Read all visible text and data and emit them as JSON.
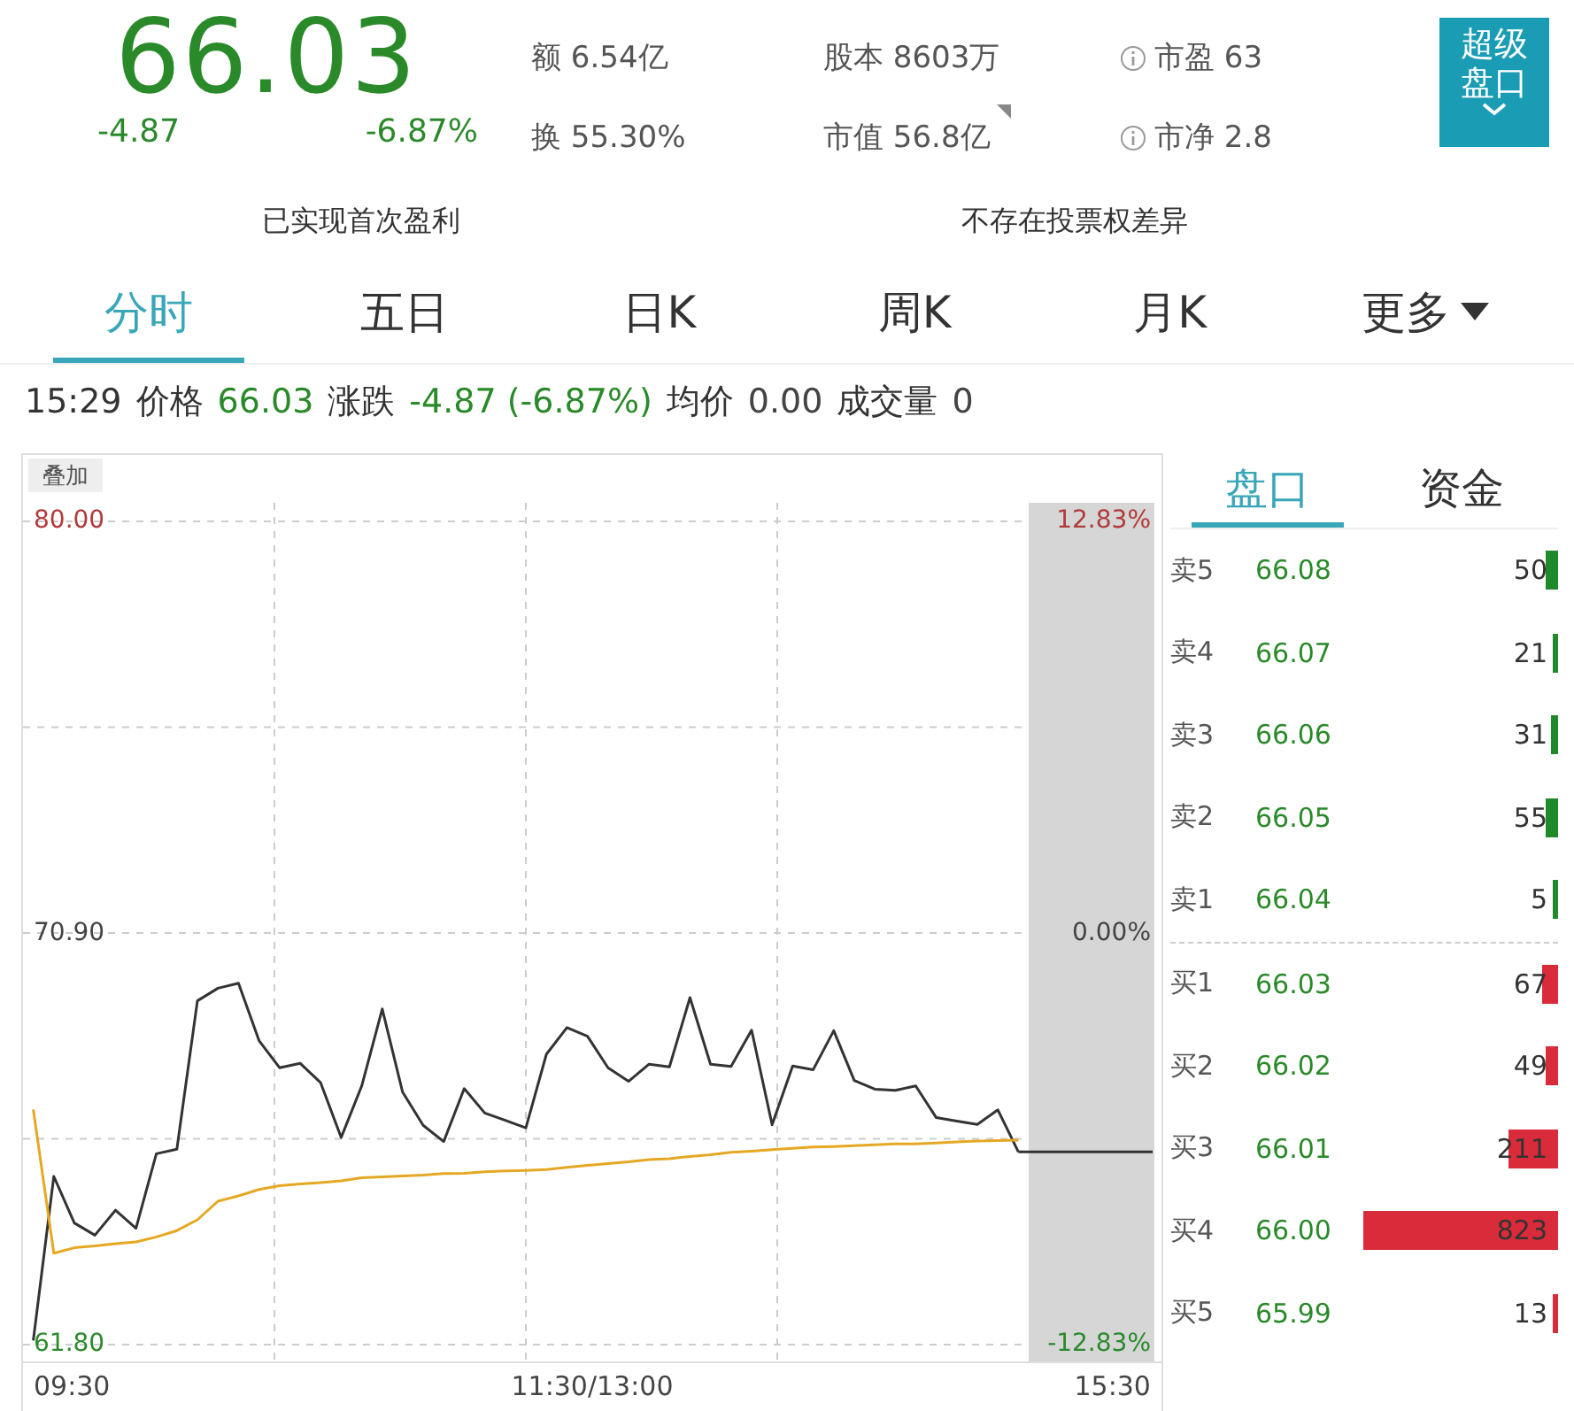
{
  "quote": {
    "price": "66.03",
    "change": "-4.87",
    "change_pct": "-6.87%"
  },
  "stats": [
    {
      "label": "额",
      "value": "6.54亿",
      "flag": false
    },
    {
      "label": "换",
      "value": "55.30%",
      "flag": false
    },
    {
      "label": "股本",
      "value": "8603万",
      "flag": false
    },
    {
      "label": "市值",
      "value": "56.8亿",
      "flag": true
    }
  ],
  "ratios": [
    {
      "label": "市盈",
      "value": "63"
    },
    {
      "label": "市净",
      "value": "2.8"
    }
  ],
  "super_button": {
    "label": "超级盘口"
  },
  "notes": [
    "已实现首次盈利",
    "不存在投票权差异"
  ],
  "tabs": [
    {
      "label": "分时",
      "selected": true,
      "dropdown": false
    },
    {
      "label": "五日",
      "selected": false,
      "dropdown": false
    },
    {
      "label": "日K",
      "selected": false,
      "dropdown": false
    },
    {
      "label": "周K",
      "selected": false,
      "dropdown": false
    },
    {
      "label": "月K",
      "selected": false,
      "dropdown": false
    },
    {
      "label": "更多",
      "selected": false,
      "dropdown": true
    }
  ],
  "info_bar": {
    "time": "15:29",
    "fields": [
      {
        "label": "价格",
        "value": "66.03",
        "color": "#2a8a2a"
      },
      {
        "label": "涨跌",
        "value": "-4.87 (-6.87%)",
        "color": "#2a8a2a"
      },
      {
        "label": "均价",
        "value": "0.00",
        "color": "#444444"
      },
      {
        "label": "成交量",
        "value": "0",
        "color": "#444444"
      }
    ]
  },
  "chart": {
    "overlay_button": "叠加",
    "percent_labels": [
      "12.83%",
      "0.00%",
      "-12.83%"
    ],
    "time_labels": [
      "09:30",
      "11:30/13:00",
      "15:30"
    ],
    "chart_data": {
      "type": "line",
      "ylim": [
        61.8,
        80
      ],
      "grid": true,
      "categories": [
        null,
        null,
        null,
        null,
        null,
        null,
        null,
        null,
        null,
        null,
        null,
        null,
        null,
        null,
        null,
        null,
        null,
        null,
        null,
        null,
        null,
        null,
        null,
        null,
        null,
        null,
        null,
        null,
        null,
        null,
        null,
        null,
        null,
        null,
        null,
        null,
        null,
        null,
        null,
        null,
        null,
        null,
        null,
        null,
        null,
        null,
        null,
        null,
        null
      ],
      "yticks": [
        {
          "value": 80,
          "label": "80.00"
        },
        {
          "value": 70.9,
          "label": "70.90"
        },
        {
          "value": 61.8,
          "label": "61.80"
        }
      ],
      "series": [
        {
          "color": "#333333",
          "values": [
            61.87,
            65.5,
            64.47,
            64.2,
            64.75,
            64.35,
            66.0,
            66.1,
            69.38,
            69.66,
            69.77,
            68.5,
            67.9,
            68.0,
            67.57,
            66.36,
            67.5,
            69.2,
            67.36,
            66.63,
            66.27,
            67.44,
            66.9,
            66.74,
            66.57,
            68.2,
            68.79,
            68.6,
            67.9,
            67.6,
            67.98,
            67.92,
            69.45,
            67.98,
            67.93,
            68.73,
            66.64,
            67.94,
            67.86,
            68.72,
            67.62,
            67.43,
            67.4,
            67.5,
            66.8,
            66.72,
            66.65,
            66.97,
            66.04
          ]
        },
        {
          "color": "#e6a823",
          "values": [
            66.98,
            63.8,
            63.92,
            63.96,
            64.01,
            64.05,
            64.16,
            64.3,
            64.54,
            64.95,
            65.07,
            65.21,
            65.29,
            65.33,
            65.36,
            65.4,
            65.47,
            65.49,
            65.51,
            65.53,
            65.56,
            65.57,
            65.6,
            65.62,
            65.63,
            65.65,
            65.7,
            65.74,
            65.78,
            65.82,
            65.87,
            65.89,
            65.94,
            65.98,
            66.03,
            66.06,
            66.09,
            66.12,
            66.15,
            66.16,
            66.18,
            66.2,
            66.22,
            66.22,
            66.24,
            66.26,
            66.28,
            66.29,
            66.3
          ]
        }
      ]
    }
  },
  "order_book": {
    "tabs": [
      {
        "label": "盘口",
        "selected": true
      },
      {
        "label": "资金",
        "selected": false
      }
    ],
    "rows": [
      {
        "kind": "sell",
        "label": "卖5",
        "price": "66.08",
        "volume": "50"
      },
      {
        "kind": "sell",
        "label": "卖4",
        "price": "66.07",
        "volume": "21"
      },
      {
        "kind": "sell",
        "label": "卖3",
        "price": "66.06",
        "volume": "31"
      },
      {
        "kind": "sell",
        "label": "卖2",
        "price": "66.05",
        "volume": "55"
      },
      {
        "kind": "sell",
        "label": "卖1",
        "price": "66.04",
        "volume": "5"
      },
      {
        "kind": "buy",
        "label": "买1",
        "price": "66.03",
        "volume": "67"
      },
      {
        "kind": "buy",
        "label": "买2",
        "price": "66.02",
        "volume": "49"
      },
      {
        "kind": "buy",
        "label": "买3",
        "price": "66.01",
        "volume": "211"
      },
      {
        "kind": "buy",
        "label": "买4",
        "price": "66.00",
        "volume": "823"
      },
      {
        "kind": "buy",
        "label": "买5",
        "price": "65.99",
        "volume": "13"
      }
    ]
  }
}
